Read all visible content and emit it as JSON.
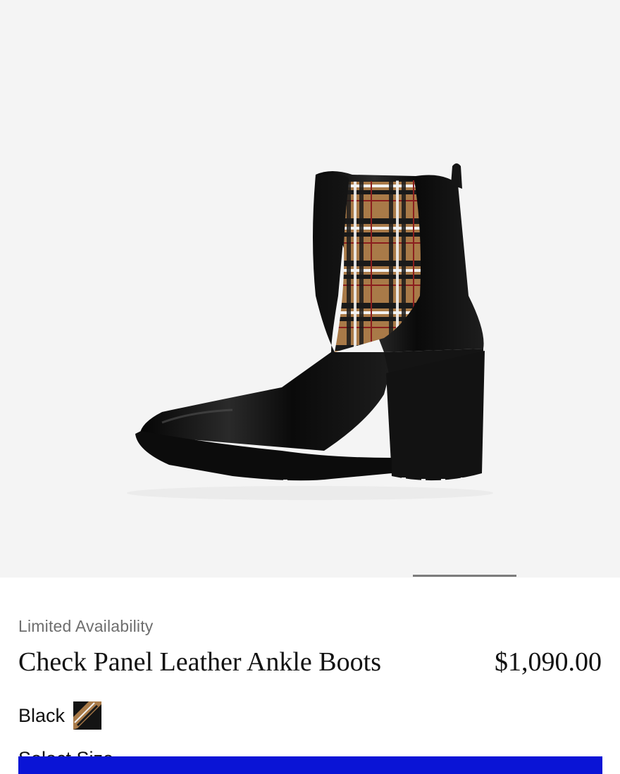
{
  "product": {
    "availability": "Limited Availability",
    "name": "Check Panel Leather Ankle Boots",
    "price": "$1,090.00",
    "color_label": "Black",
    "size_label": "Select Size"
  },
  "gallery": {
    "image_subject": "black leather ankle boot with check panel",
    "background_color": "#f4f4f4",
    "indicator_color": "#7c7c7c"
  },
  "cta": {
    "color": "#0a14d6"
  }
}
